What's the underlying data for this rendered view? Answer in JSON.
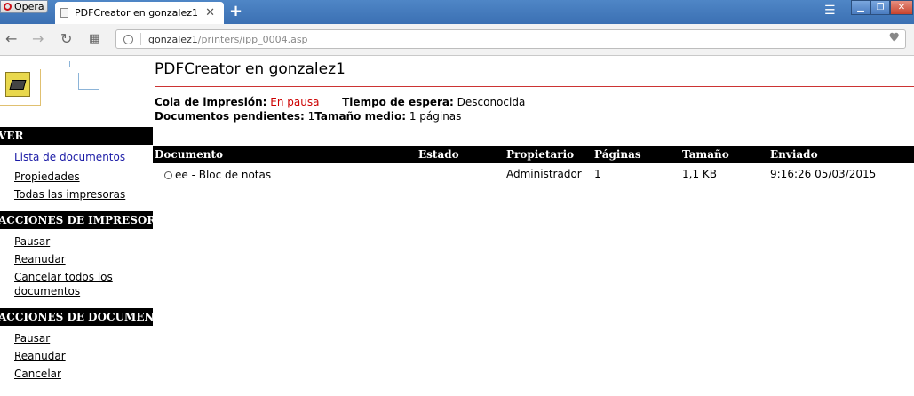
{
  "browser": {
    "menu_label": "Opera",
    "tab_title": "PDFCreator en gonzalez1",
    "url_host": "gonzalez1",
    "url_path": "/printers/ipp_0004.asp"
  },
  "page": {
    "title": "PDFCreator en gonzalez1",
    "queue_label": "Cola de impresión:",
    "queue_value": "En pausa",
    "wait_label": "Tiempo de espera:",
    "wait_value": "Desconocida",
    "pending_label": "Documentos pendientes:",
    "pending_value": "1",
    "avg_label": "Tamaño medio:",
    "avg_value": "1 páginas"
  },
  "sidebar": {
    "sections": [
      {
        "header": "VER",
        "items": [
          "Lista de documentos",
          "Propiedades",
          "Todas las impresoras"
        ]
      },
      {
        "header": "ACCIONES DE IMPRESORAS",
        "items": [
          "Pausar",
          "Reanudar",
          "Cancelar todos los documentos"
        ]
      },
      {
        "header": "ACCIONES DE DOCUMENTOS",
        "items": [
          "Pausar",
          "Reanudar",
          "Cancelar"
        ]
      }
    ]
  },
  "table": {
    "columns": [
      "Documento",
      "Estado",
      "Propietario",
      "Páginas",
      "Tamaño",
      "Enviado"
    ],
    "rows": [
      {
        "document": "ee - Bloc de notas",
        "status": "",
        "owner": "Administrador",
        "pages": "1",
        "size": "1,1 KB",
        "sent": "9:16:26 05/03/2015"
      }
    ]
  },
  "colors": {
    "accent_red": "#cc0000",
    "header_black": "#000000",
    "link_blue": "#1a1aa6"
  }
}
